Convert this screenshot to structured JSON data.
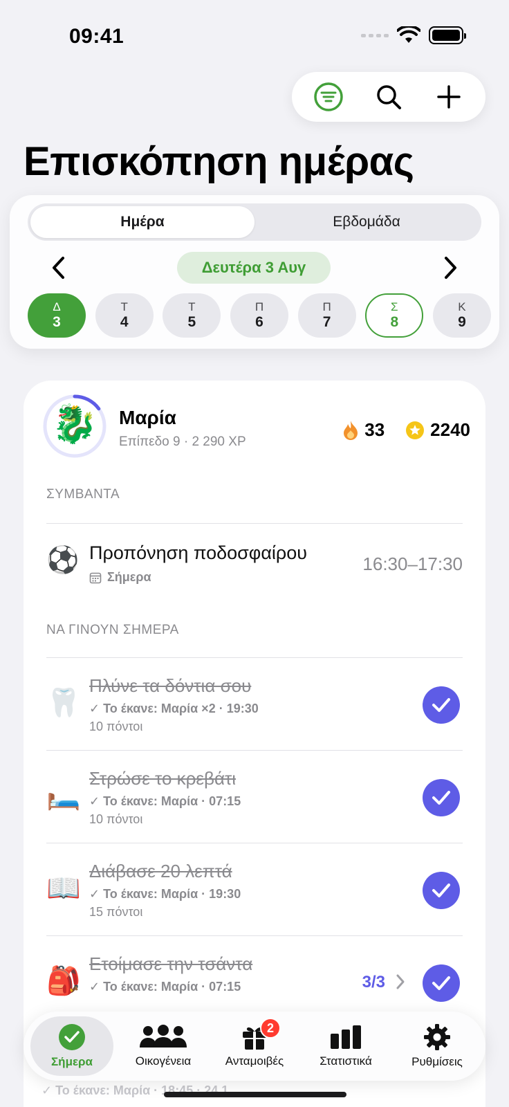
{
  "status_bar": {
    "time": "09:41"
  },
  "header": {
    "title": "Επισκόπηση ημέρας"
  },
  "calendar": {
    "segments": [
      "Ημέρα",
      "Εβδομάδα"
    ],
    "active_segment": "Ημέρα",
    "current_date": "Δευτέρα 3 Αυγ",
    "days": [
      {
        "letter": "Δ",
        "num": "3",
        "state": "selected"
      },
      {
        "letter": "Τ",
        "num": "4",
        "state": "normal"
      },
      {
        "letter": "Τ",
        "num": "5",
        "state": "normal"
      },
      {
        "letter": "Π",
        "num": "6",
        "state": "normal"
      },
      {
        "letter": "Π",
        "num": "7",
        "state": "normal"
      },
      {
        "letter": "Σ",
        "num": "8",
        "state": "today"
      },
      {
        "letter": "Κ",
        "num": "9",
        "state": "normal"
      }
    ]
  },
  "profile": {
    "name": "Μαρία",
    "subtitle": "Επίπεδο 9 · 2 290 XP",
    "level_progress": 0.15,
    "streak": "33",
    "coins": "2240",
    "avatar_icon": "dragon-icon"
  },
  "events_section": {
    "label": "ΣΥΜΒΑΝΤΑ",
    "items": [
      {
        "icon": "soccer-ball-icon",
        "title": "Προπόνηση ποδοσφαίρου",
        "subtitle": "Σήμερα",
        "time": "16:30–17:30"
      }
    ]
  },
  "tasks_section": {
    "label": "ΝΑ ΓΙΝΟΥΝ ΣΗΜΕΡΑ",
    "items": [
      {
        "icon": "tooth-icon",
        "title": "Πλύνε τα δόντια σου",
        "done": "✓ Το έκανε: Μαρία ×2 · 19:30",
        "points": "10 πόντοι"
      },
      {
        "icon": "bed-icon",
        "title": "Στρώσε το κρεβάτι",
        "done": "✓ Το έκανε: Μαρία · 07:15",
        "points": "10 πόντοι"
      },
      {
        "icon": "book-icon",
        "title": "Διάβασε 20 λεπτά",
        "done": "✓ Το έκανε: Μαρία · 19:30",
        "points": "15 πόντοι"
      },
      {
        "icon": "backpack-icon",
        "title": "Ετοίμασε την τσάντα",
        "done": "✓ Το έκανε: Μαρία · 07:15",
        "points": "",
        "progress": "3/3"
      }
    ],
    "partially_hidden": "✓ Το έκανε: Μαρία · 18:45 · 24,1"
  },
  "tab_bar": {
    "tabs": [
      {
        "label": "Σήμερα",
        "icon": "checkmark-circle-icon",
        "active": true
      },
      {
        "label": "Οικογένεια",
        "icon": "people-icon",
        "active": false
      },
      {
        "label": "Ανταμοιβές",
        "icon": "gift-icon",
        "active": false,
        "badge": "2"
      },
      {
        "label": "Στατιστικά",
        "icon": "bar-chart-icon",
        "active": false
      },
      {
        "label": "Ρυθμίσεις",
        "icon": "gear-icon",
        "active": false
      }
    ]
  },
  "colors": {
    "accent_green": "#43a03a",
    "accent_purple": "#5e5ce6",
    "badge_red": "#ff3b30"
  }
}
